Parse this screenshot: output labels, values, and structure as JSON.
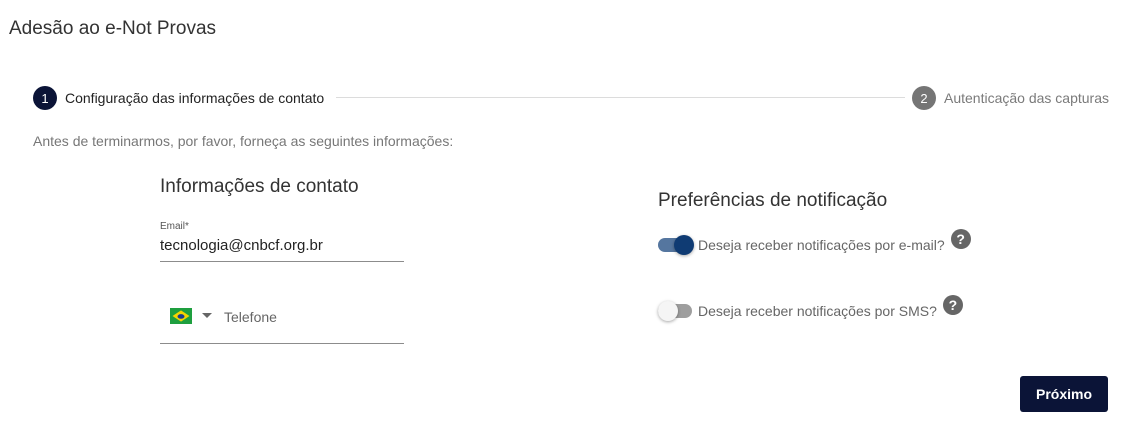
{
  "page": {
    "title": "Adesão ao e-Not Provas"
  },
  "stepper": {
    "steps": [
      {
        "number": "1",
        "label": "Configuração das informações de contato"
      },
      {
        "number": "2",
        "label": "Autenticação das capturas"
      }
    ]
  },
  "intro": "Antes de terminarmos, por favor, forneça as seguintes informações:",
  "contact": {
    "title": "Informações de contato",
    "email_label": "Email*",
    "email_value": "tecnologia@cnbcf.org.br",
    "phone_placeholder": "Telefone",
    "country_flag_icon": "brazil-flag-icon"
  },
  "notifications": {
    "title": "Preferências de notificação",
    "email_toggle": {
      "label": "Deseja receber notificações por e-mail?",
      "checked": true,
      "help_icon": "?"
    },
    "sms_toggle": {
      "label": "Deseja receber notificações por SMS?",
      "checked": false,
      "help_icon": "?"
    }
  },
  "actions": {
    "next_label": "Próximo"
  },
  "colors": {
    "primary": "#0b1437",
    "toggle_on": "#0f3b73",
    "step_inactive": "#757575"
  }
}
